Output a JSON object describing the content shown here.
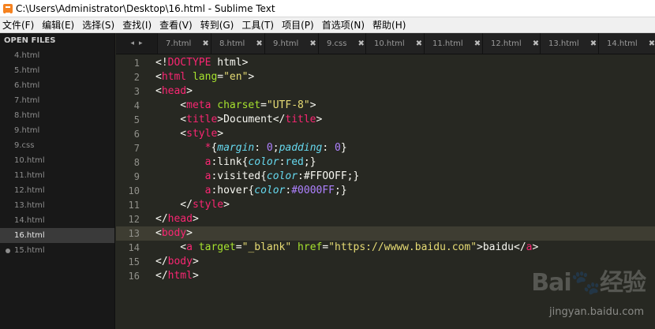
{
  "window": {
    "title": "C:\\Users\\Administrator\\Desktop\\16.html - Sublime Text"
  },
  "menu": {
    "items": [
      "文件(F)",
      "编辑(E)",
      "选择(S)",
      "查找(I)",
      "查看(V)",
      "转到(G)",
      "工具(T)",
      "项目(P)",
      "首选项(N)",
      "帮助(H)"
    ]
  },
  "sidebar": {
    "header": "OPEN FILES",
    "files": [
      "4.html",
      "5.html",
      "6.html",
      "7.html",
      "8.html",
      "9.html",
      "9.css",
      "10.html",
      "11.html",
      "12.html",
      "13.html",
      "14.html",
      "16.html",
      "15.html"
    ],
    "active_file": "16.html",
    "dirty_file": "15.html"
  },
  "tabs": {
    "nav_left": "◂",
    "nav_right": "▸",
    "items": [
      "7.html",
      "8.html",
      "9.html",
      "9.css",
      "10.html",
      "11.html",
      "12.html",
      "13.html",
      "14.html"
    ],
    "close_glyph": "✖"
  },
  "editor": {
    "current_line": 13,
    "line_numbers": [
      "1",
      "2",
      "3",
      "4",
      "5",
      "6",
      "7",
      "8",
      "9",
      "10",
      "11",
      "12",
      "13",
      "14",
      "15",
      "16"
    ],
    "colors": {
      "background": "#272822",
      "tag": "#f92672",
      "attribute": "#a6e22e",
      "string": "#e6db74",
      "property": "#66d9ef",
      "number": "#ae81ff"
    },
    "code": {
      "l1": [
        "<!",
        "DOCTYPE",
        " html",
        ">"
      ],
      "l2": [
        "<",
        "html",
        " ",
        "lang",
        "=",
        "\"en\"",
        ">"
      ],
      "l3": [
        "<",
        "head",
        ">"
      ],
      "l4": [
        "    <",
        "meta",
        " ",
        "charset",
        "=",
        "\"UTF-8\"",
        ">"
      ],
      "l5": [
        "    <",
        "title",
        ">Document</",
        "title",
        ">"
      ],
      "l6": [
        "    <",
        "style",
        ">"
      ],
      "l7": [
        "        ",
        "*",
        "{",
        "margin",
        ": ",
        "0",
        ";",
        "padding",
        ": ",
        "0",
        "}"
      ],
      "l8": [
        "        ",
        "a",
        ":link{",
        "color",
        ":",
        "red",
        ";}"
      ],
      "l9": [
        "        ",
        "a",
        ":visited{",
        "color",
        ":#FFOOFF;}"
      ],
      "l10": [
        "        ",
        "a",
        ":hover{",
        "color",
        ":",
        "#0000FF",
        ";}"
      ],
      "l11": [
        "    </",
        "style",
        ">"
      ],
      "l12": [
        "</",
        "head",
        ">"
      ],
      "l13": [
        "<",
        "body",
        ">"
      ],
      "l14": [
        "    <",
        "a",
        " ",
        "target",
        "=",
        "\"_blank\"",
        " ",
        "href",
        "=",
        "\"https://wwww.baidu.com\"",
        ">baidu</",
        "a",
        ">"
      ],
      "l15": [
        "</",
        "body",
        ">"
      ],
      "l16": [
        "</",
        "html",
        ">"
      ]
    }
  },
  "watermark": {
    "brand": "Bai🐾经验",
    "url": "jingyan.baidu.com"
  }
}
